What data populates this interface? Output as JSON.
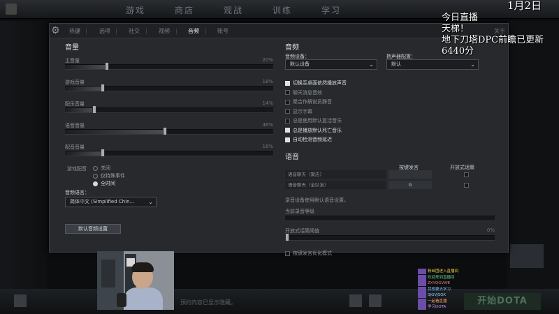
{
  "topbar": {
    "nav": [
      "游戏",
      "商店",
      "观战",
      "训练",
      "学习"
    ]
  },
  "settings": {
    "tabs": [
      "热键",
      "选项",
      "社交",
      "视频",
      "音频",
      "账号"
    ],
    "active_tab": "音频",
    "close_label": "关于",
    "audio": {
      "title": "音量",
      "sliders": [
        {
          "label": "主音量",
          "value": "20%",
          "fraction": 0.2
        },
        {
          "label": "游戏音量",
          "value": "18%",
          "fraction": 0.18
        },
        {
          "label": "配乐音量",
          "value": "14%",
          "fraction": 0.14
        },
        {
          "label": "语音音量",
          "value": "48%",
          "fraction": 0.48
        },
        {
          "label": "配音音量",
          "value": "18%",
          "fraction": 0.18
        }
      ],
      "game_voice_label": "游戏配音",
      "game_voice_options": [
        {
          "label": "关闭",
          "selected": false
        },
        {
          "label": "仅特殊事件",
          "selected": false
        },
        {
          "label": "全时间",
          "selected": true
        }
      ],
      "voice_language_label": "音频语言：",
      "voice_language_value": "简体中文 (Simplified Chin...",
      "reset_button": "默认音频设置"
    },
    "right": {
      "title": "音频",
      "device_label": "音频设备：",
      "device_value": "默认设备",
      "speaker_label": "扬声器配置：",
      "speaker_value": "默认",
      "checkboxes": [
        {
          "label": "切换至桌面依然播放声音",
          "checked": true
        },
        {
          "label": "聊天消息音效",
          "checked": false
        },
        {
          "label": "聚合作解说员静音",
          "checked": false
        },
        {
          "label": "显示字幕",
          "checked": false
        },
        {
          "label": "总是使用默认复活音乐",
          "checked": false
        },
        {
          "label": "总是播放默认死亡音乐",
          "checked": true
        },
        {
          "label": "自动检测音频延迟",
          "checked": true
        }
      ]
    },
    "voice": {
      "title": "语音",
      "col_ptt": "按键发言",
      "col_open": "开放式话筒",
      "rows": [
        {
          "label": "语音聊天（聚店）",
          "key": "",
          "open": false
        },
        {
          "label": "语音聊天（全队友）",
          "key": "G",
          "open": false
        }
      ],
      "record_note": "录音设备使用默认语音设置。",
      "current_level_label": "当前录音等级",
      "threshold_label": "开放式话筒阈值",
      "threshold_value": "0%",
      "ptt_opt_label": "按键发言优化模式"
    }
  },
  "bottombar": {
    "note": "预约内容已显示隐藏。",
    "play_label": "开始DOTA"
  },
  "chat": {
    "lines": [
      {
        "text": "粉丝团进入直播间",
        "color": "#f3d24a"
      },
      {
        "text": "欢迎来到直播间",
        "color": "#66d28a"
      },
      {
        "text": "ZXYQGVWE",
        "color": "#f07a7a"
      },
      {
        "text": "我想要去学习",
        "color": "#7fb6f5"
      },
      {
        "text": "SJGVJSOX",
        "color": "#8fd0ff"
      },
      {
        "text": "一起看直播",
        "color": "#f2a36b"
      },
      {
        "text": "学习DOTA",
        "color": "#c59af2"
      }
    ]
  },
  "overlay": {
    "date": "1月2日",
    "lines": [
      "今日直播",
      "天梯！",
      "地下刀塔DPC前瞻已更新",
      "6440分"
    ]
  }
}
